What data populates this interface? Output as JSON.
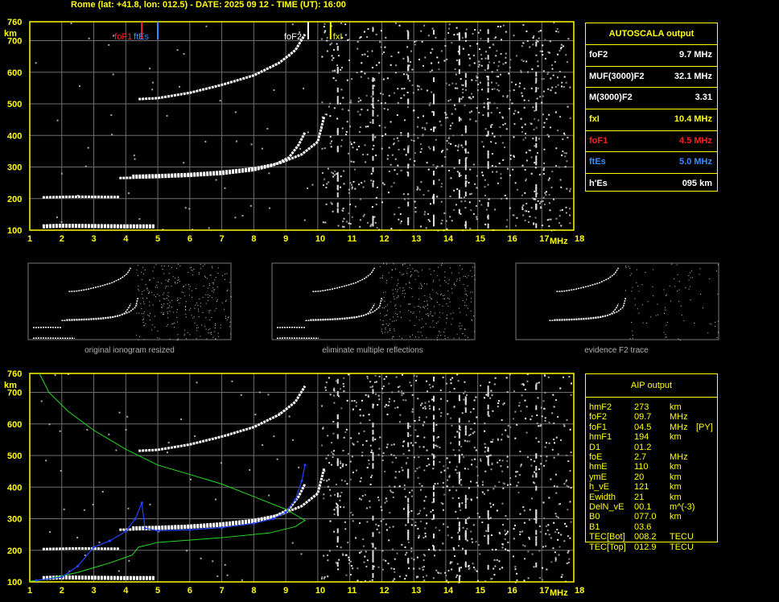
{
  "header": "Rome (lat: +41.8, lon: 012.5) - DATE: 2025 09 12 - TIME (UT): 16:00",
  "chart_data": [
    {
      "type": "scatter",
      "title": "",
      "xlabel": "MHz",
      "ylabel": "km",
      "xlim": [
        1,
        18
      ],
      "ylim": [
        100,
        760
      ],
      "x_ticks": [
        "1",
        "2",
        "3",
        "4",
        "5",
        "6",
        "7",
        "8",
        "9",
        "10",
        "11",
        "12",
        "13",
        "14",
        "15",
        "16",
        "17",
        "18"
      ],
      "y_ticks": [
        "100",
        "200",
        "300",
        "400",
        "500",
        "600",
        "700",
        "760"
      ],
      "grid": true,
      "markers": [
        {
          "label": "foF1",
          "freq": 4.5,
          "color": "#ff2020"
        },
        {
          "label": "ftEs",
          "freq": 5.0,
          "color": "#3c8cff"
        },
        {
          "label": "foF2",
          "freq": 9.7,
          "color": "#ffffff"
        },
        {
          "label": "fxI",
          "freq": 10.4,
          "color": "#ffff00"
        }
      ],
      "traces": [
        {
          "name": "Es",
          "points": [
            [
              1.4,
              112
            ],
            [
              2,
              114
            ],
            [
              3,
              113
            ],
            [
              4,
              112
            ],
            [
              4.9,
              112
            ]
          ]
        },
        {
          "name": "Es-2",
          "points": [
            [
              1.4,
              204
            ],
            [
              2.5,
              206
            ],
            [
              3.5,
              205
            ],
            [
              3.8,
              205
            ]
          ]
        },
        {
          "name": "F2-o",
          "points": [
            [
              3.8,
              265
            ],
            [
              5,
              268
            ],
            [
              6,
              272
            ],
            [
              7,
              278
            ],
            [
              8,
              290
            ],
            [
              8.6,
              305
            ],
            [
              9.1,
              330
            ],
            [
              9.4,
              370
            ],
            [
              9.6,
              410
            ]
          ]
        },
        {
          "name": "F2-x",
          "points": [
            [
              4.2,
              272
            ],
            [
              5,
              274
            ],
            [
              6,
              278
            ],
            [
              7,
              285
            ],
            [
              8,
              296
            ],
            [
              8.8,
              312
            ],
            [
              9.5,
              340
            ],
            [
              10.0,
              380
            ],
            [
              10.2,
              460
            ]
          ]
        },
        {
          "name": "F2-high",
          "points": [
            [
              4.4,
              515
            ],
            [
              5,
              518
            ],
            [
              6,
              535
            ],
            [
              7,
              560
            ],
            [
              8,
              590
            ],
            [
              8.8,
              630
            ],
            [
              9.3,
              670
            ],
            [
              9.6,
              720
            ]
          ]
        }
      ]
    },
    {
      "type": "scatter",
      "title": "",
      "xlabel": "MHz",
      "ylabel": "km",
      "xlim": [
        1,
        18
      ],
      "ylim": [
        100,
        760
      ],
      "x_ticks": [
        "1",
        "2",
        "3",
        "4",
        "5",
        "6",
        "7",
        "8",
        "9",
        "10",
        "11",
        "12",
        "13",
        "14",
        "15",
        "16",
        "17",
        "18"
      ],
      "y_ticks": [
        "100",
        "200",
        "300",
        "400",
        "500",
        "600",
        "700",
        "760"
      ],
      "grid": true,
      "profile": [
        [
          1.3,
          760
        ],
        [
          1.6,
          700
        ],
        [
          2.2,
          640
        ],
        [
          3,
          580
        ],
        [
          4,
          520
        ],
        [
          5,
          470
        ],
        [
          6,
          440
        ],
        [
          7,
          410
        ],
        [
          8,
          370
        ],
        [
          9,
          330
        ],
        [
          9.6,
          295
        ],
        [
          9.3,
          275
        ],
        [
          8.5,
          255
        ],
        [
          7,
          240
        ],
        [
          5,
          225
        ],
        [
          4.4,
          210
        ],
        [
          4.2,
          185
        ],
        [
          3.5,
          160
        ],
        [
          2.5,
          130
        ],
        [
          1.5,
          108
        ],
        [
          1,
          102
        ]
      ],
      "model_trace": [
        [
          1.2,
          105
        ],
        [
          2,
          115
        ],
        [
          2.5,
          150
        ],
        [
          3,
          210
        ],
        [
          3.5,
          230
        ],
        [
          4,
          260
        ],
        [
          4.3,
          300
        ],
        [
          4.5,
          350
        ],
        [
          4.6,
          270
        ],
        [
          5,
          262
        ],
        [
          6,
          265
        ],
        [
          7,
          272
        ],
        [
          8,
          285
        ],
        [
          8.6,
          300
        ],
        [
          9,
          320
        ],
        [
          9.3,
          360
        ],
        [
          9.5,
          420
        ],
        [
          9.6,
          470
        ]
      ]
    }
  ],
  "autoscala": {
    "title": "AUTOSCALA output",
    "rows": [
      {
        "label": "foF2",
        "value": "9.7 MHz",
        "color": "#ffffff"
      },
      {
        "label": "MUF(3000)F2",
        "value": "32.1 MHz",
        "color": "#ffffff"
      },
      {
        "label": "M(3000)F2",
        "value": "3.31",
        "color": "#ffffff"
      },
      {
        "label": "fxI",
        "value": "10.4 MHz",
        "color": "#ffff00"
      },
      {
        "label": "foF1",
        "value": "4.5 MHz",
        "color": "#ff2020"
      },
      {
        "label": "ftEs",
        "value": "5.0 MHz",
        "color": "#3c8cff"
      },
      {
        "label": "h'Es",
        "value": "095    km",
        "color": "#ffffff"
      }
    ]
  },
  "thumbnails": [
    {
      "caption": "original ionogram resized"
    },
    {
      "caption": "eliminate multiple reflections"
    },
    {
      "caption": "evidence F2 trace"
    }
  ],
  "aip": {
    "title": "AIP output",
    "rows": [
      {
        "name": "hmF2",
        "value": "273",
        "unit": "km",
        "extra": ""
      },
      {
        "name": "foF2",
        "value": "09.7",
        "unit": "MHz",
        "extra": ""
      },
      {
        "name": "foF1",
        "value": "04.5",
        "unit": "MHz",
        "extra": "[PY]"
      },
      {
        "name": "hmF1",
        "value": "194",
        "unit": "km",
        "extra": ""
      },
      {
        "name": "D1",
        "value": "01.2",
        "unit": "",
        "extra": ""
      },
      {
        "name": "foE",
        "value": "2.7",
        "unit": "MHz",
        "extra": ""
      },
      {
        "name": "hmE",
        "value": "110",
        "unit": "km",
        "extra": ""
      },
      {
        "name": "ymE",
        "value": "20",
        "unit": "km",
        "extra": ""
      },
      {
        "name": "h_vE",
        "value": "121",
        "unit": "km",
        "extra": ""
      },
      {
        "name": "Ewidth",
        "value": "21",
        "unit": "km",
        "extra": ""
      },
      {
        "name": "DelN_vE",
        "value": "00.1",
        "unit": "m^(-3)",
        "extra": ""
      },
      {
        "name": "B0",
        "value": "077.0",
        "unit": "km",
        "extra": ""
      },
      {
        "name": "B1",
        "value": "03.6",
        "unit": "",
        "extra": ""
      },
      {
        "name": "TEC[Bot]",
        "value": "008.2",
        "unit": "TECU",
        "extra": ""
      },
      {
        "name": "TEC[Top]",
        "value": "012.9",
        "unit": "TECU",
        "extra": ""
      }
    ]
  }
}
